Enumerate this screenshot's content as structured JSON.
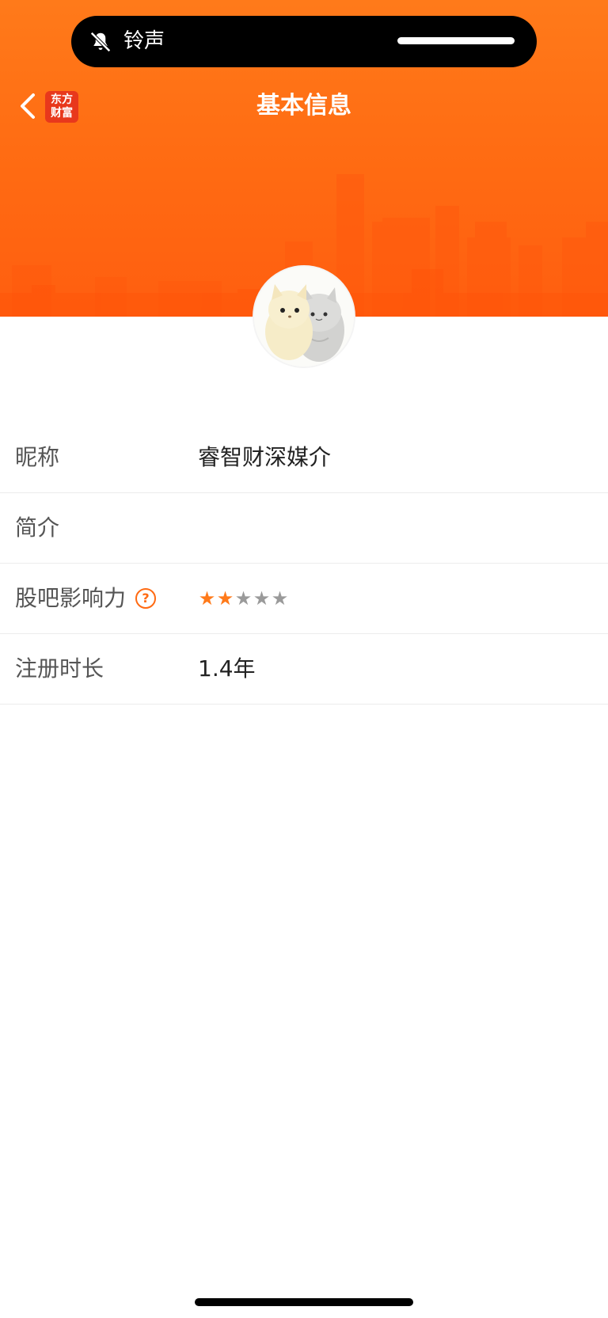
{
  "status": {
    "mode_label": "铃声",
    "mode_icon": "bell-slash-icon"
  },
  "nav": {
    "title": "基本信息",
    "back_icon": "chevron-left-icon",
    "logo_line1": "东方",
    "logo_line2": "财富"
  },
  "profile": {
    "avatar": "cats-avatar"
  },
  "info": {
    "nickname": {
      "label": "昵称",
      "value": "睿智财深媒介"
    },
    "bio": {
      "label": "简介",
      "value": ""
    },
    "influence": {
      "label": "股吧影响力",
      "help_icon": "question-circle-icon",
      "rating": 2,
      "max": 5
    },
    "registration": {
      "label": "注册时长",
      "value": "1.4年"
    }
  },
  "colors": {
    "brand_orange": "#ff6a12",
    "star_active": "#ff7a1a",
    "star_inactive": "#9a9a9a",
    "logo_red": "#e8381c"
  }
}
